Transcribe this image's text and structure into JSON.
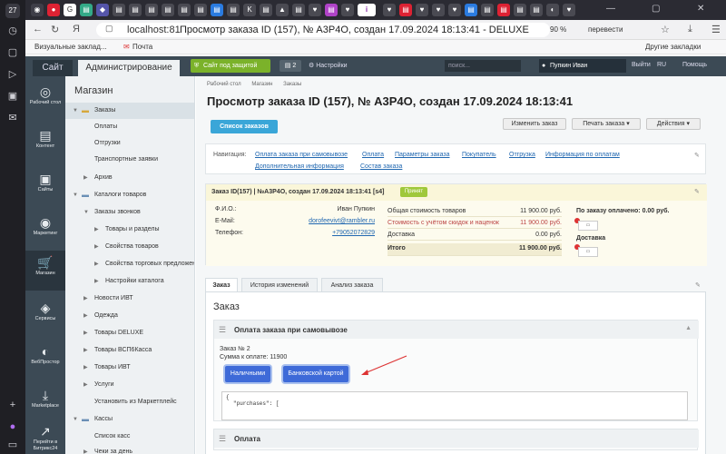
{
  "browser": {
    "tab_counter": "27",
    "url_host": "localhost:81",
    "page_title": "Просмотр заказа ID (157), № А3Р4О, создан 17.09.2024 18:13:41 - DELUXE",
    "zoom": "90 %",
    "translate": "перевести",
    "bookmarks": [
      "Визуальные заклад...",
      "Почта"
    ],
    "other_bookmarks": "Другие закладки",
    "left_counter": "27"
  },
  "bx_panel": {
    "tab_site": "Сайт",
    "tab_admin": "Администрирование",
    "protect": "Сайт под защитой",
    "count": "2",
    "settings": "Настройки",
    "search_placeholder": "поиск...",
    "user": "Пупкин Иван",
    "exit": "Выйти",
    "lang": "RU",
    "help": "Помощь"
  },
  "iconbar": [
    {
      "label": "Рабочий стол",
      "icon": "desktop-icon"
    },
    {
      "label": "Контент",
      "icon": "content-icon"
    },
    {
      "label": "Сайты",
      "icon": "sites-icon"
    },
    {
      "label": "Маркетинг",
      "icon": "marketing-icon"
    },
    {
      "label": "Магазин",
      "icon": "shop-icon"
    },
    {
      "label": "Сервисы",
      "icon": "services-icon"
    },
    {
      "label": "ВебПростор",
      "icon": "webprostor-icon"
    },
    {
      "label": "Marketplace",
      "icon": "marketplace-icon"
    },
    {
      "label": "Перейти в Битрикс24",
      "icon": "bitrix24-icon"
    }
  ],
  "tree": {
    "title": "Магазин",
    "items": [
      {
        "label": "Заказы"
      },
      {
        "label": "Оплаты"
      },
      {
        "label": "Отгрузки"
      },
      {
        "label": "Транспортные заявки"
      },
      {
        "label": "Архив"
      },
      {
        "label": "Каталоги товаров"
      },
      {
        "label": "Заказы звонков"
      },
      {
        "label": "Товары и разделы"
      },
      {
        "label": "Свойства товаров"
      },
      {
        "label": "Свойства торговых предложений"
      },
      {
        "label": "Настройки каталога"
      },
      {
        "label": "Новости ИВТ"
      },
      {
        "label": "Одежда"
      },
      {
        "label": "Товары DELUXE"
      },
      {
        "label": "Товары ВСП6Касса"
      },
      {
        "label": "Товары ИВТ"
      },
      {
        "label": "Услуги"
      },
      {
        "label": "Установить из Маркетплейс"
      },
      {
        "label": "Кассы"
      },
      {
        "label": "Список касс"
      },
      {
        "label": "Чеки за день"
      }
    ]
  },
  "main": {
    "crumbs": [
      "Рабочий стол",
      "Магазин",
      "Заказы"
    ],
    "title": "Просмотр заказа ID (157), № А3Р4О, создан 17.09.2024 18:13:41",
    "btn_list": "Список заказов",
    "btn_edit": "Изменить заказ",
    "btn_print": "Печать заказа",
    "btn_actions": "Действия",
    "nav_label": "Навигация:",
    "nav_links": [
      "Оплата заказа при самовывозе",
      "Оплата",
      "Параметры заказа",
      "Покупатель",
      "Отгрузка",
      "Информация по оплатам",
      "Дополнительная информация",
      "Состав заказа"
    ],
    "order_head": "Заказ ID(157) | №А3Р4О, создан 17.09.2024 18:13:41 [s4]",
    "order_status": "Принят",
    "fio_label": "Ф.И.О.:",
    "fio": "Иван Пупкин",
    "email_label": "E-Mail:",
    "email": "dorofeevivt@rambler.ru",
    "phone_label": "Телефон:",
    "phone": "+79052072829",
    "sums": [
      {
        "label": "Общая стоимость товаров",
        "value": "11 900.00 руб."
      },
      {
        "label": "Стоимость с учётом скидок и наценок",
        "value": "11 900.00 руб."
      },
      {
        "label": "Доставка",
        "value": "0.00 руб."
      },
      {
        "label": "Итого",
        "value": "11 900.00 руб."
      }
    ],
    "paid_label": "По заказу оплачено: 0.00 руб.",
    "delivery_label": "Доставка",
    "tabs": [
      "Заказ",
      "История изменений",
      "Анализ заказа"
    ],
    "order_title": "Заказ",
    "section1_title": "Оплата заказа при самовывозе",
    "order_no": "Заказ № 2",
    "sum_to_pay": "Сумма к оплате: 11900",
    "btn_cash": "Наличными",
    "btn_card": "Банковской картой",
    "code_line1": "{",
    "code_line2": "\"purchases\": [",
    "section2_title": "Оплата"
  }
}
